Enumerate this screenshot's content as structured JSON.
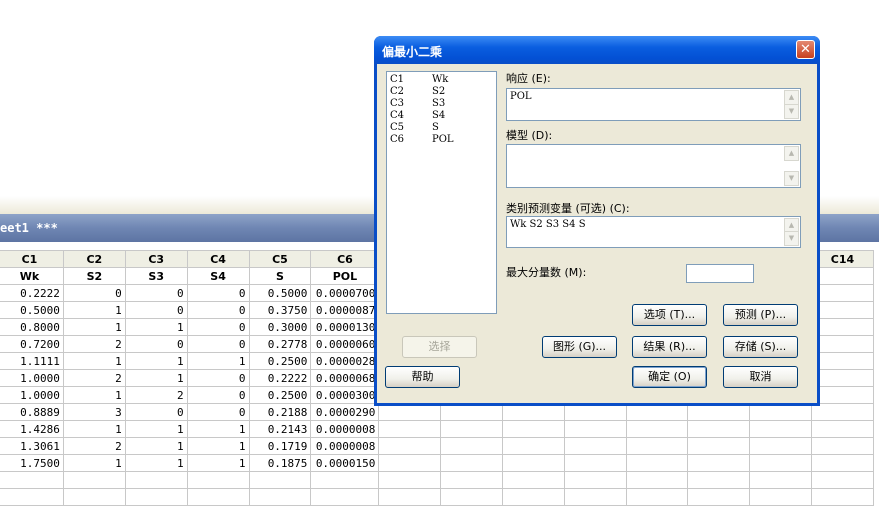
{
  "worksheet": {
    "title": "eet1 ***",
    "columns": [
      "C1",
      "C2",
      "C3",
      "C4",
      "C5",
      "C6",
      "",
      "",
      "",
      "",
      "",
      "",
      "",
      "C14"
    ],
    "names": [
      "Wk",
      "S2",
      "S3",
      "S4",
      "S",
      "POL",
      "",
      "",
      "",
      "",
      "",
      "",
      "",
      ""
    ],
    "rows": [
      [
        "0.2222",
        "0",
        "0",
        "0",
        "0.5000",
        "0.0000700"
      ],
      [
        "0.5000",
        "1",
        "0",
        "0",
        "0.3750",
        "0.0000087"
      ],
      [
        "0.8000",
        "1",
        "1",
        "0",
        "0.3000",
        "0.0000130"
      ],
      [
        "0.7200",
        "2",
        "0",
        "0",
        "0.2778",
        "0.0000060"
      ],
      [
        "1.1111",
        "1",
        "1",
        "1",
        "0.2500",
        "0.0000028"
      ],
      [
        "1.0000",
        "2",
        "1",
        "0",
        "0.2222",
        "0.0000068"
      ],
      [
        "1.0000",
        "1",
        "2",
        "0",
        "0.2500",
        "0.0000300"
      ],
      [
        "0.8889",
        "3",
        "0",
        "0",
        "0.2188",
        "0.0000290"
      ],
      [
        "1.4286",
        "1",
        "1",
        "1",
        "0.2143",
        "0.0000008"
      ],
      [
        "1.3061",
        "2",
        "1",
        "1",
        "0.1719",
        "0.0000008"
      ],
      [
        "1.7500",
        "1",
        "1",
        "1",
        "0.1875",
        "0.0000150"
      ],
      [
        "",
        "",
        "",
        "",
        "",
        ""
      ],
      [
        "",
        "",
        "",
        "",
        "",
        ""
      ]
    ]
  },
  "dialog": {
    "title": "偏最小二乘",
    "close_icon": "close-icon",
    "variables": [
      {
        "col": "C1",
        "name": "Wk"
      },
      {
        "col": "C2",
        "name": "S2"
      },
      {
        "col": "C3",
        "name": "S3"
      },
      {
        "col": "C4",
        "name": "S4"
      },
      {
        "col": "C5",
        "name": "S"
      },
      {
        "col": "C6",
        "name": "POL"
      }
    ],
    "response_label": "响应 (E):",
    "response_value": "POL",
    "model_label": "模型 (D):",
    "model_value": "",
    "categorical_label": "类别预测变量 (可选) (C):",
    "categorical_value": "Wk S2 S3 S4 S",
    "max_components_label": "最大分量数 (M):",
    "max_components_value": "",
    "buttons": {
      "options": "选项 (T)...",
      "prediction": "预测 (P)...",
      "select": "选择",
      "graphs": "图形 (G)...",
      "results": "结果 (R)...",
      "storage": "存储 (S)...",
      "help": "帮助",
      "ok": "确定 (O)",
      "cancel": "取消"
    }
  }
}
